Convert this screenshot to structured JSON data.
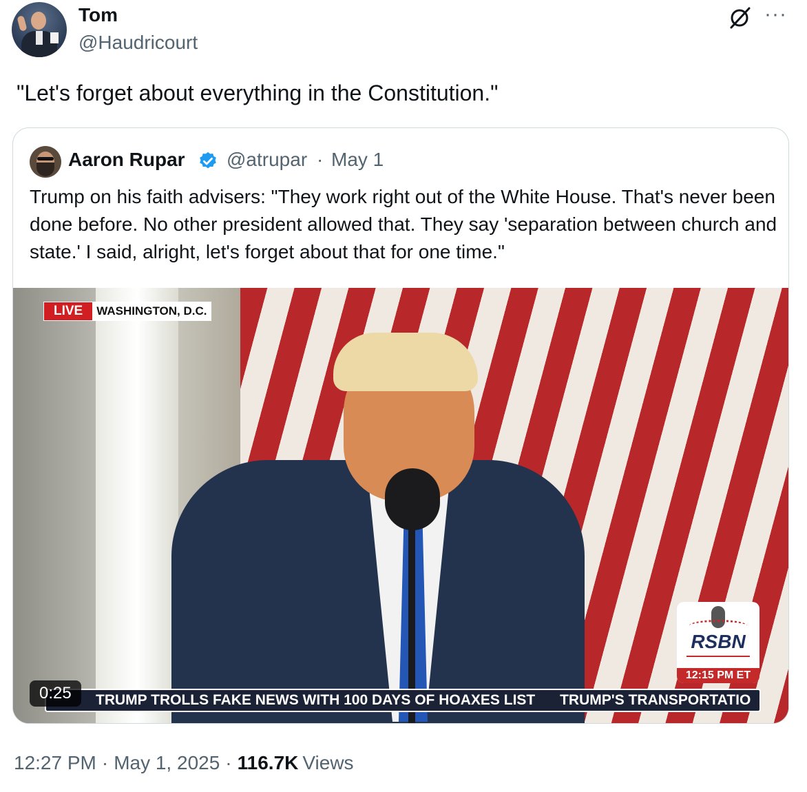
{
  "author": {
    "name": "Tom",
    "handle": "@Haudricourt"
  },
  "tweet": {
    "text": "\"Let's forget about everything in the Constitution.\""
  },
  "quoted": {
    "name": "Aaron Rupar",
    "handle": "@atrupar",
    "separator": "·",
    "date": "May 1",
    "text": "Trump on his faith advisers: \"They work right out of the White House. That's never been done before. No other president allowed that. They say 'separation between church and state.' I said, alright, let's forget about that for one time.\"",
    "video": {
      "live_label": "LIVE",
      "location": "WASHINGTON, D.C.",
      "network": "RSBN",
      "network_time": "12:15 PM ET",
      "ticker": [
        "TRUMP TROLLS FAKE NEWS WITH 100 DAYS OF HOAXES LIST",
        "TRUMP'S TRANSPORTATIO"
      ],
      "duration": "0:25"
    }
  },
  "meta": {
    "time": "12:27 PM",
    "separator": "·",
    "date": "May 1, 2025",
    "views_count": "116.7K",
    "views_label": "Views"
  },
  "icons": {
    "grok": "grok-icon",
    "more": "more-icon",
    "verified": "verified-badge-icon"
  },
  "colors": {
    "accent": "#1d9bf0",
    "secondary_text": "#536471",
    "border": "#cfd9de",
    "live_red": "#d11e23"
  }
}
